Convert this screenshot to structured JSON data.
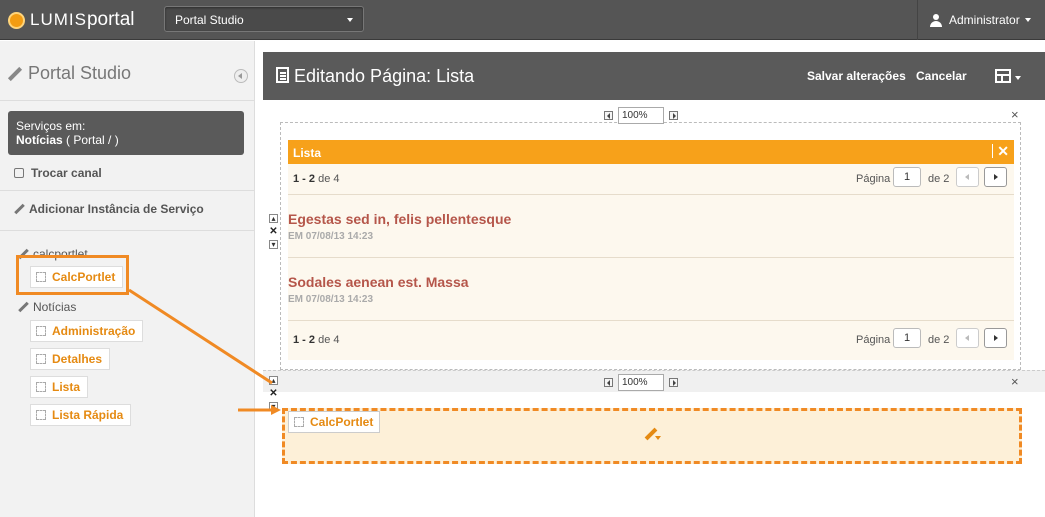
{
  "topbar": {
    "logo_text": "LUMIS",
    "logo_text_b": "portal",
    "channel_select_value": "Portal Studio",
    "user_name": "Administrator",
    "brand_color": "#f39c12"
  },
  "sidebar": {
    "title": "Portal Studio",
    "services_label": "Serviços em:",
    "services_value_bold": "Notícias",
    "services_value_path": " ( Portal / )",
    "switch_channel": "Trocar canal",
    "add_service_instance": "Adicionar Instância de Serviço",
    "groups": [
      {
        "label": "calcportlet",
        "items": [
          {
            "label": "CalcPortlet"
          }
        ]
      },
      {
        "label": "Notícias",
        "items": [
          {
            "label": "Administração"
          },
          {
            "label": "Detalhes"
          },
          {
            "label": "Lista"
          },
          {
            "label": "Lista Rápida"
          }
        ]
      }
    ]
  },
  "main": {
    "title": "Editando Página: Lista",
    "save_label": "Salvar alterações",
    "cancel_label": "Cancelar",
    "zoom_top": "100%",
    "zoom_bottom": "100%",
    "close_glyph": "×"
  },
  "portlet": {
    "title": "Lista",
    "close_glyph": "✕",
    "pager_top": {
      "range_bold": "1 - 2",
      "range_rest": " de 4",
      "page_label": "Página",
      "page_value": "1",
      "of_label": "de 2"
    },
    "pager_bottom": {
      "range_bold": "1 - 2",
      "range_rest": " de 4",
      "page_label": "Página",
      "page_value": "1",
      "of_label": "de 2"
    },
    "items": [
      {
        "title": "Egestas sed in, felis pellentesque",
        "date": "EM 07/08/13 14:23"
      },
      {
        "title": "Sodales aenean est. Massa",
        "date": "EM 07/08/13 14:23"
      }
    ]
  },
  "drag": {
    "chip_label": "CalcPortlet",
    "accent_color": "#f08a24"
  }
}
